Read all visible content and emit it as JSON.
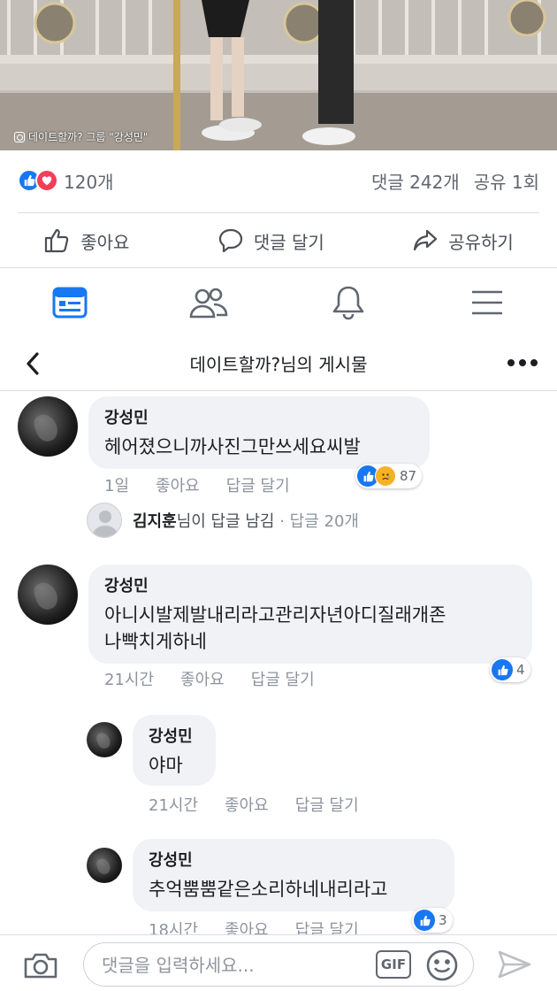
{
  "photo": {
    "watermark": "데이트할까? 그룹 \"강성민\""
  },
  "summary": {
    "reaction_count": "120개",
    "comments": "댓글 242개",
    "shares": "공유 1회"
  },
  "actions": {
    "like": "좋아요",
    "comment": "댓글 달기",
    "share": "공유하기"
  },
  "tabs": [
    "news-feed",
    "friends",
    "notifications",
    "menu"
  ],
  "header": {
    "title": "데이트할까?님의 게시물"
  },
  "comments": [
    {
      "name": "강성민",
      "text": "헤어졌으니까사진그만쓰세요씨발",
      "time": "1일",
      "like": "좋아요",
      "reply": "답글 달기",
      "reactions": "87"
    },
    {
      "name": "강성민",
      "text_line1": "아니시발제발내리라고관리자년아디질래개존",
      "text_line2": "나빡치게하네",
      "time": "21시간",
      "like": "좋아요",
      "reply": "답글 달기",
      "reactions": "4"
    }
  ],
  "reply_summary": {
    "name": "김지훈",
    "suffix": "님이 답글 남김",
    "count": "· 답글 20개"
  },
  "replies": [
    {
      "name": "강성민",
      "text": "야마",
      "time": "21시간",
      "like": "좋아요",
      "reply": "답글 달기"
    },
    {
      "name": "강성민",
      "text": "추억뿜뿜같은소리하네내리라고",
      "time": "18시간",
      "like": "좋아요",
      "reply": "답글 달기",
      "reactions": "3"
    }
  ],
  "composer": {
    "placeholder": "댓글을 입력하세요...",
    "gif": "GIF"
  },
  "colors": {
    "accent": "#1877f2",
    "love": "#f33e58",
    "bubble": "#f0f2f5"
  }
}
